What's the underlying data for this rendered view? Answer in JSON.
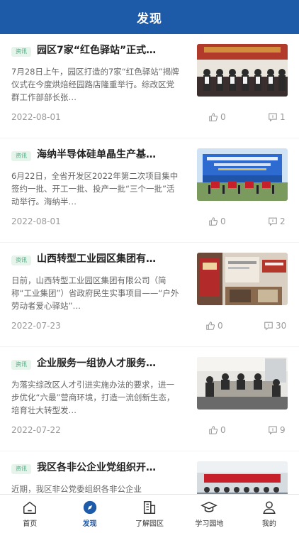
{
  "header": {
    "title": "发现"
  },
  "articles": [
    {
      "tag": "资讯",
      "title": "园区7家“红色驿站”正式…",
      "summary": "7月28日上午，园区打造的7家“红色驿站”揭牌仪式在今度烘焙经园路店隆重举行。综改区党群工作部部长张…",
      "date": "2022-08-01",
      "likes": "0",
      "comments": "1"
    },
    {
      "tag": "资讯",
      "title": "海纳半导体硅单晶生产基…",
      "summary": "6月22日，全省开发区2022年第二次项目集中签约一批、开工一批、投产一批“三个一批”活动举行。海纳半…",
      "date": "2022-08-01",
      "likes": "0",
      "comments": "2"
    },
    {
      "tag": "资讯",
      "title": "山西转型工业园区集团有…",
      "summary": "日前，山西转型工业园区集团有限公司（简称“工业集团”）省政府民生实事项目——“户外劳动者爱心驿站”…",
      "date": "2022-07-23",
      "likes": "0",
      "comments": "30"
    },
    {
      "tag": "资讯",
      "title": "企业服务一组协人才服务…",
      "summary": "为落实综改区人才引进实施办法的要求，进一步优化“六最”营商环境，打造一流创新生态，培育壮大转型发…",
      "date": "2022-07-22",
      "likes": "0",
      "comments": "9"
    },
    {
      "tag": "资讯",
      "title": "我区各非公企业党组织开…",
      "summary": "近期，我区非公党委组织各非公企业",
      "date": "",
      "likes": "",
      "comments": ""
    }
  ],
  "tabs": [
    {
      "label": "首页",
      "icon": "home-icon"
    },
    {
      "label": "发现",
      "icon": "compass-icon"
    },
    {
      "label": "了解园区",
      "icon": "building-icon"
    },
    {
      "label": "学习园地",
      "icon": "graduation-cap-icon"
    },
    {
      "label": "我的",
      "icon": "user-icon"
    }
  ],
  "colors": {
    "brand": "#1d5aa8",
    "tag_green": "#4aa57c"
  }
}
